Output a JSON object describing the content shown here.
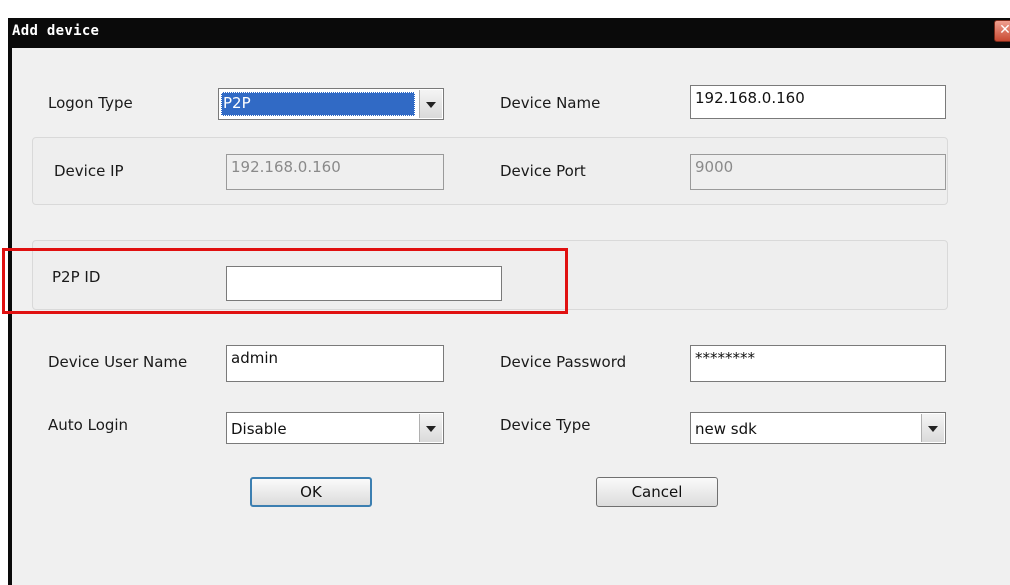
{
  "window": {
    "title": "Add device",
    "close_glyph": "✕"
  },
  "logon_type": {
    "label": "Logon Type",
    "value": "P2P"
  },
  "device_name": {
    "label": "Device Name",
    "value": "192.168.0.160"
  },
  "device_ip": {
    "label": "Device IP",
    "value": "192.168.0.160"
  },
  "device_port": {
    "label": "Device Port",
    "value": "9000"
  },
  "p2p_id": {
    "label": "P2P ID",
    "value": ""
  },
  "user_name": {
    "label": "Device User Name",
    "value": "admin"
  },
  "password": {
    "label": "Device Password",
    "value": "********"
  },
  "auto_login": {
    "label": "Auto Login",
    "value": "Disable"
  },
  "device_type": {
    "label": "Device Type",
    "value": "new sdk"
  },
  "buttons": {
    "ok": "OK",
    "cancel": "Cancel"
  },
  "colors": {
    "highlight": "#e01010",
    "selection": "#316ac5",
    "titlebar": "#0a0a0a"
  }
}
